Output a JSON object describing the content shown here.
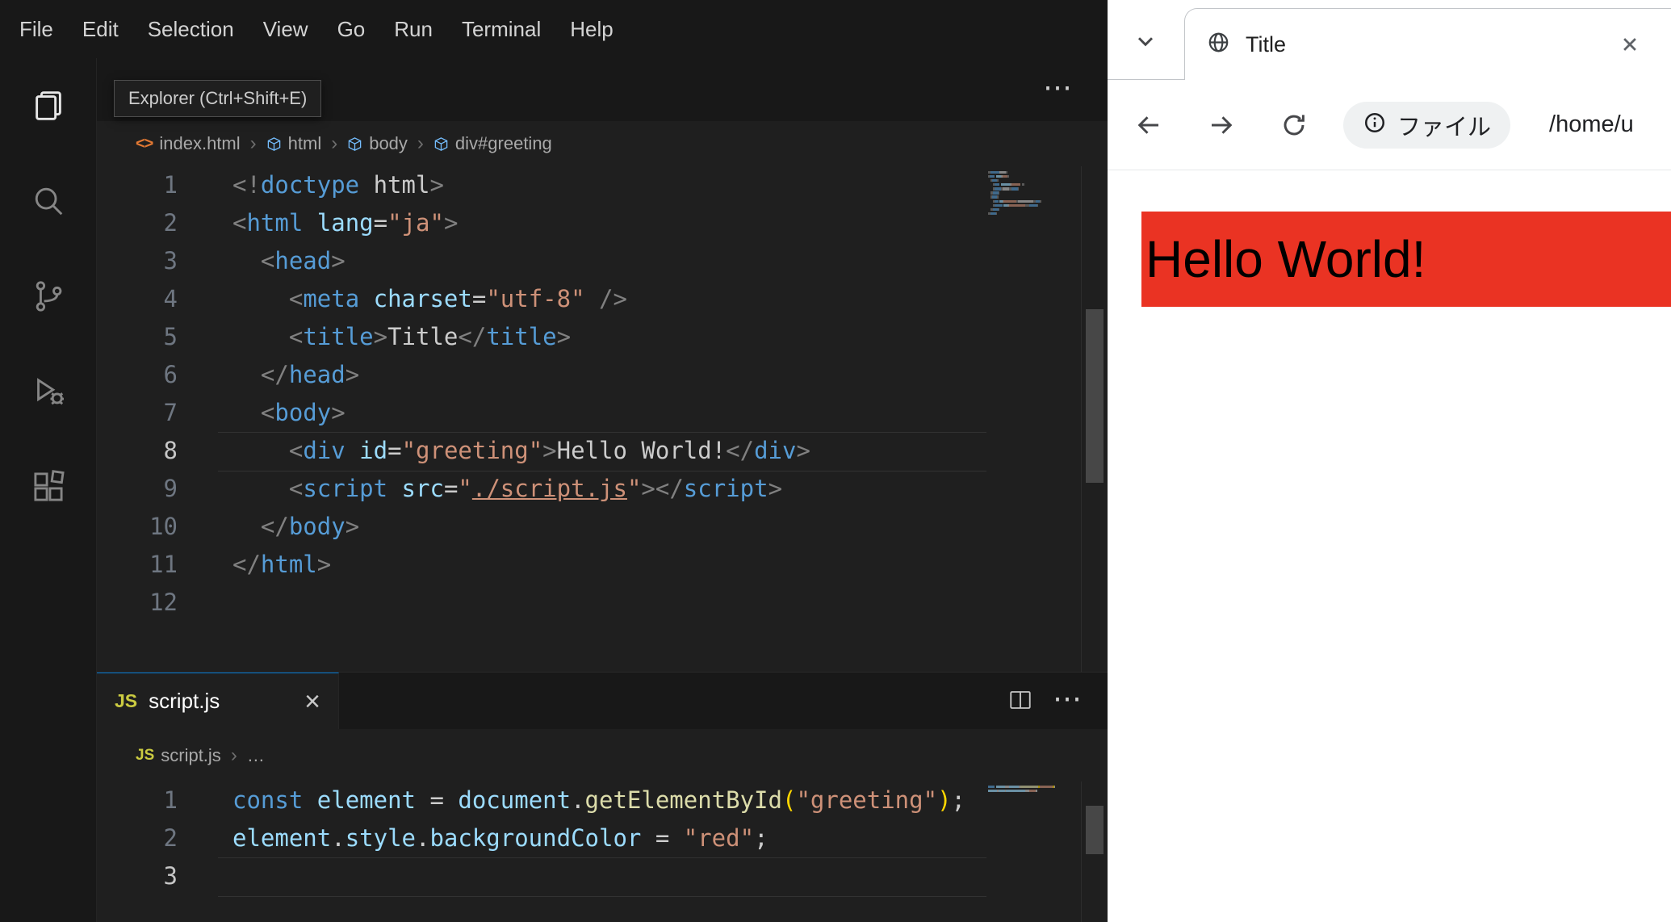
{
  "icons": {
    "more_actions": "⋯",
    "close": "×",
    "breadcrumb_sep": "›"
  },
  "vscode": {
    "menu": [
      "File",
      "Edit",
      "Selection",
      "View",
      "Go",
      "Run",
      "Terminal",
      "Help"
    ],
    "tooltip": "Explorer (Ctrl+Shift+E)",
    "activity_bar": [
      "explorer",
      "search",
      "source-control",
      "run-and-debug",
      "extensions"
    ],
    "token_colors": {
      "tag": "#569cd6",
      "punct": "#808080",
      "attr": "#9cdcfe",
      "str": "#ce9178",
      "text": "#cccccc",
      "kw": "#569cd6",
      "var": "#9cdcfe",
      "fn": "#dcdcaa",
      "br": "#ffd700",
      "link": "#ce9178"
    },
    "top_editor": {
      "breadcrumb": [
        {
          "icon": "html",
          "label": "index.html"
        },
        {
          "icon": "element",
          "label": "html"
        },
        {
          "icon": "element",
          "label": "body"
        },
        {
          "icon": "element",
          "label": "div#greeting"
        }
      ],
      "lines": [
        {
          "n": "1",
          "t": [
            [
              "punct",
              "<!"
            ],
            [
              "tag",
              "doctype"
            ],
            [
              "text",
              " html"
            ],
            [
              "punct",
              ">"
            ]
          ]
        },
        {
          "n": "2",
          "t": [
            [
              "punct",
              "<"
            ],
            [
              "tag",
              "html"
            ],
            [
              "text",
              " "
            ],
            [
              "attr",
              "lang"
            ],
            [
              "text",
              "="
            ],
            [
              "str",
              "\"ja\""
            ],
            [
              "punct",
              ">"
            ]
          ]
        },
        {
          "n": "3",
          "t": [
            [
              "text",
              "  "
            ],
            [
              "punct",
              "<"
            ],
            [
              "tag",
              "head"
            ],
            [
              "punct",
              ">"
            ]
          ]
        },
        {
          "n": "4",
          "t": [
            [
              "text",
              "    "
            ],
            [
              "punct",
              "<"
            ],
            [
              "tag",
              "meta"
            ],
            [
              "text",
              " "
            ],
            [
              "attr",
              "charset"
            ],
            [
              "text",
              "="
            ],
            [
              "str",
              "\"utf-8\""
            ],
            [
              "text",
              " "
            ],
            [
              "punct",
              "/>"
            ]
          ]
        },
        {
          "n": "5",
          "t": [
            [
              "text",
              "    "
            ],
            [
              "punct",
              "<"
            ],
            [
              "tag",
              "title"
            ],
            [
              "punct",
              ">"
            ],
            [
              "text",
              "Title"
            ],
            [
              "punct",
              "</"
            ],
            [
              "tag",
              "title"
            ],
            [
              "punct",
              ">"
            ]
          ]
        },
        {
          "n": "6",
          "t": [
            [
              "text",
              "  "
            ],
            [
              "punct",
              "</"
            ],
            [
              "tag",
              "head"
            ],
            [
              "punct",
              ">"
            ]
          ]
        },
        {
          "n": "7",
          "t": [
            [
              "text",
              "  "
            ],
            [
              "punct",
              "<"
            ],
            [
              "tag",
              "body"
            ],
            [
              "punct",
              ">"
            ]
          ]
        },
        {
          "n": "8",
          "cur": true,
          "t": [
            [
              "text",
              "    "
            ],
            [
              "punct",
              "<"
            ],
            [
              "tag",
              "div"
            ],
            [
              "text",
              " "
            ],
            [
              "attr",
              "id"
            ],
            [
              "text",
              "="
            ],
            [
              "str",
              "\"greeting\""
            ],
            [
              "punct",
              ">"
            ],
            [
              "text",
              "Hello World!"
            ],
            [
              "punct",
              "</"
            ],
            [
              "tag",
              "div"
            ],
            [
              "punct",
              ">"
            ]
          ]
        },
        {
          "n": "9",
          "t": [
            [
              "text",
              "    "
            ],
            [
              "punct",
              "<"
            ],
            [
              "tag",
              "script"
            ],
            [
              "text",
              " "
            ],
            [
              "attr",
              "src"
            ],
            [
              "text",
              "="
            ],
            [
              "str",
              "\""
            ],
            [
              "link",
              "./script.js"
            ],
            [
              "str",
              "\""
            ],
            [
              "punct",
              ">"
            ],
            [
              "punct",
              "</"
            ],
            [
              "tag",
              "script"
            ],
            [
              "punct",
              ">"
            ]
          ]
        },
        {
          "n": "10",
          "t": [
            [
              "text",
              "  "
            ],
            [
              "punct",
              "</"
            ],
            [
              "tag",
              "body"
            ],
            [
              "punct",
              ">"
            ]
          ]
        },
        {
          "n": "11",
          "t": [
            [
              "punct",
              "</"
            ],
            [
              "tag",
              "html"
            ],
            [
              "punct",
              ">"
            ]
          ]
        },
        {
          "n": "12",
          "t": []
        }
      ]
    },
    "bottom_editor": {
      "tab": {
        "icon": "JS",
        "label": "script.js"
      },
      "breadcrumb": [
        {
          "icon": "js",
          "label": "script.js"
        },
        {
          "icon": "",
          "label": "…"
        }
      ],
      "lines": [
        {
          "n": "1",
          "t": [
            [
              "kw",
              "const"
            ],
            [
              "text",
              " "
            ],
            [
              "var",
              "element"
            ],
            [
              "text",
              " = "
            ],
            [
              "var",
              "document"
            ],
            [
              "text",
              "."
            ],
            [
              "fn",
              "getElementById"
            ],
            [
              "br",
              "("
            ],
            [
              "str",
              "\"greeting\""
            ],
            [
              "br",
              ")"
            ],
            [
              "text",
              ";"
            ]
          ]
        },
        {
          "n": "2",
          "t": [
            [
              "var",
              "element"
            ],
            [
              "text",
              "."
            ],
            [
              "var",
              "style"
            ],
            [
              "text",
              "."
            ],
            [
              "var",
              "backgroundColor"
            ],
            [
              "text",
              " = "
            ],
            [
              "str",
              "\"red\""
            ],
            [
              "text",
              ";"
            ]
          ]
        },
        {
          "n": "3",
          "cur": true,
          "t": []
        }
      ]
    }
  },
  "browser": {
    "tab": {
      "title": "Title"
    },
    "toolbar": {
      "chip_label": "ファイル",
      "url": "/home/u"
    },
    "page": {
      "heading": "Hello World!",
      "heading_bg": "#ea3323",
      "heading_color": "#000000"
    }
  }
}
